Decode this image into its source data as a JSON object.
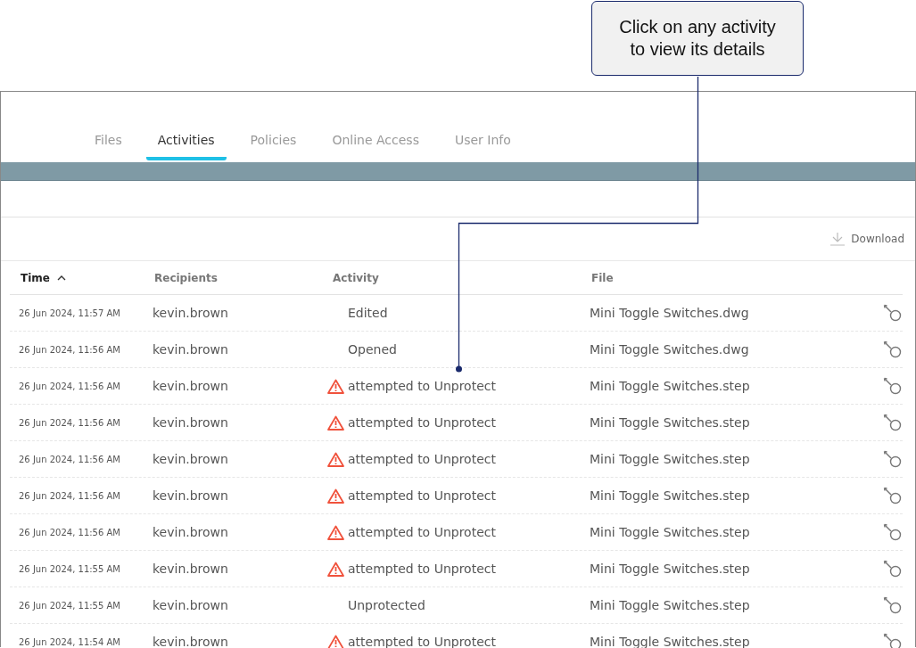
{
  "callout": {
    "text": "Click on any activity to view its details"
  },
  "tabs": [
    {
      "label": "Files",
      "selected": false
    },
    {
      "label": "Activities",
      "selected": true
    },
    {
      "label": "Policies",
      "selected": false
    },
    {
      "label": "Online Access",
      "selected": false
    },
    {
      "label": "User Info",
      "selected": false
    }
  ],
  "toolbar": {
    "download": "Download"
  },
  "table": {
    "columns": [
      {
        "label": "Time",
        "sorted": true
      },
      {
        "label": "Recipients",
        "sorted": false
      },
      {
        "label": "Activity",
        "sorted": false
      },
      {
        "label": "File",
        "sorted": false
      }
    ],
    "rows": [
      {
        "time": "26 Jun 2024, 11:57 AM",
        "recipient": "kevin.brown",
        "activity": "Edited",
        "warning": false,
        "file": "Mini Toggle Switches.dwg"
      },
      {
        "time": "26 Jun 2024, 11:56 AM",
        "recipient": "kevin.brown",
        "activity": "Opened",
        "warning": false,
        "file": "Mini Toggle Switches.dwg"
      },
      {
        "time": "26 Jun 2024, 11:56 AM",
        "recipient": "kevin.brown",
        "activity": "attempted to Unprotect",
        "warning": true,
        "file": "Mini Toggle Switches.step"
      },
      {
        "time": "26 Jun 2024, 11:56 AM",
        "recipient": "kevin.brown",
        "activity": "attempted to Unprotect",
        "warning": true,
        "file": "Mini Toggle Switches.step"
      },
      {
        "time": "26 Jun 2024, 11:56 AM",
        "recipient": "kevin.brown",
        "activity": "attempted to Unprotect",
        "warning": true,
        "file": "Mini Toggle Switches.step"
      },
      {
        "time": "26 Jun 2024, 11:56 AM",
        "recipient": "kevin.brown",
        "activity": "attempted to Unprotect",
        "warning": true,
        "file": "Mini Toggle Switches.step"
      },
      {
        "time": "26 Jun 2024, 11:56 AM",
        "recipient": "kevin.brown",
        "activity": "attempted to Unprotect",
        "warning": true,
        "file": "Mini Toggle Switches.step"
      },
      {
        "time": "26 Jun 2024, 11:55 AM",
        "recipient": "kevin.brown",
        "activity": "attempted to Unprotect",
        "warning": true,
        "file": "Mini Toggle Switches.step"
      },
      {
        "time": "26 Jun 2024, 11:55 AM",
        "recipient": "kevin.brown",
        "activity": "Unprotected",
        "warning": false,
        "file": "Mini Toggle Switches.step"
      },
      {
        "time": "26 Jun 2024, 11:54 AM",
        "recipient": "kevin.brown",
        "activity": "attempted to Unprotect",
        "warning": true,
        "file": "Mini Toggle Switches.step"
      }
    ]
  }
}
